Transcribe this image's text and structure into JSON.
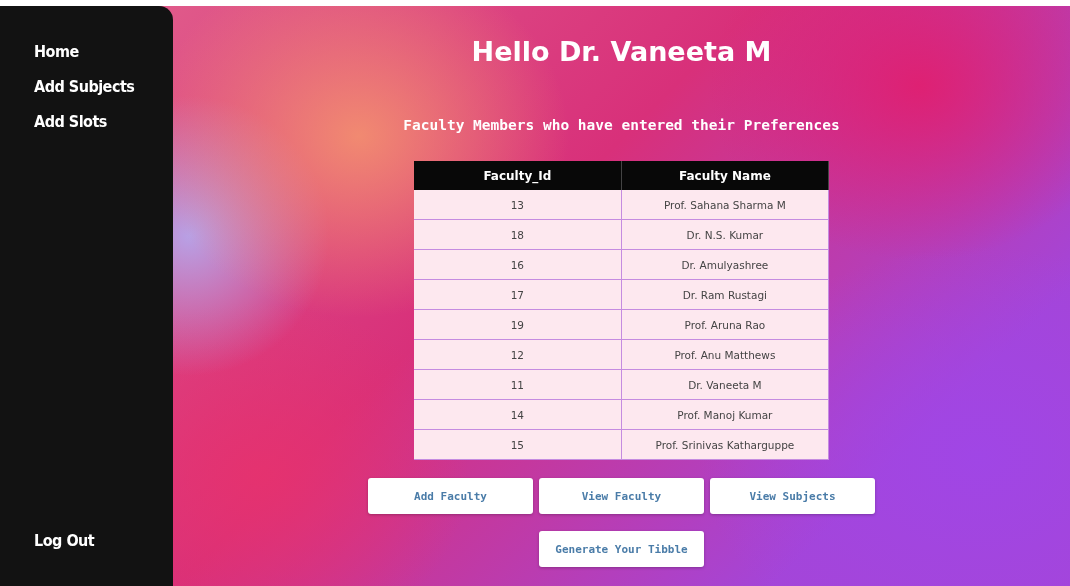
{
  "sidebar": {
    "items": [
      {
        "label": "Home"
      },
      {
        "label": "Add Subjects"
      },
      {
        "label": "Add Slots"
      }
    ],
    "logout": "Log Out"
  },
  "title": "Hello Dr. Vaneeta M",
  "subtitle": "Faculty Members who have entered their Preferences",
  "table": {
    "columns": [
      "Faculty_Id",
      "Faculty Name"
    ],
    "rows": [
      [
        "13",
        "Prof. Sahana Sharma M"
      ],
      [
        "18",
        "Dr. N.S. Kumar"
      ],
      [
        "16",
        "Dr. Amulyashree"
      ],
      [
        "17",
        "Dr. Ram Rustagi"
      ],
      [
        "19",
        "Prof. Aruna Rao"
      ],
      [
        "12",
        "Prof. Anu Matthews"
      ],
      [
        "11",
        "Dr. Vaneeta M"
      ],
      [
        "14",
        "Prof. Manoj Kumar"
      ],
      [
        "15",
        "Prof. Srinivas Katharguppe"
      ]
    ]
  },
  "buttons": [
    "Add Faculty",
    "View Faculty",
    "View Subjects"
  ],
  "generate_button": "Generate Your Tibble"
}
